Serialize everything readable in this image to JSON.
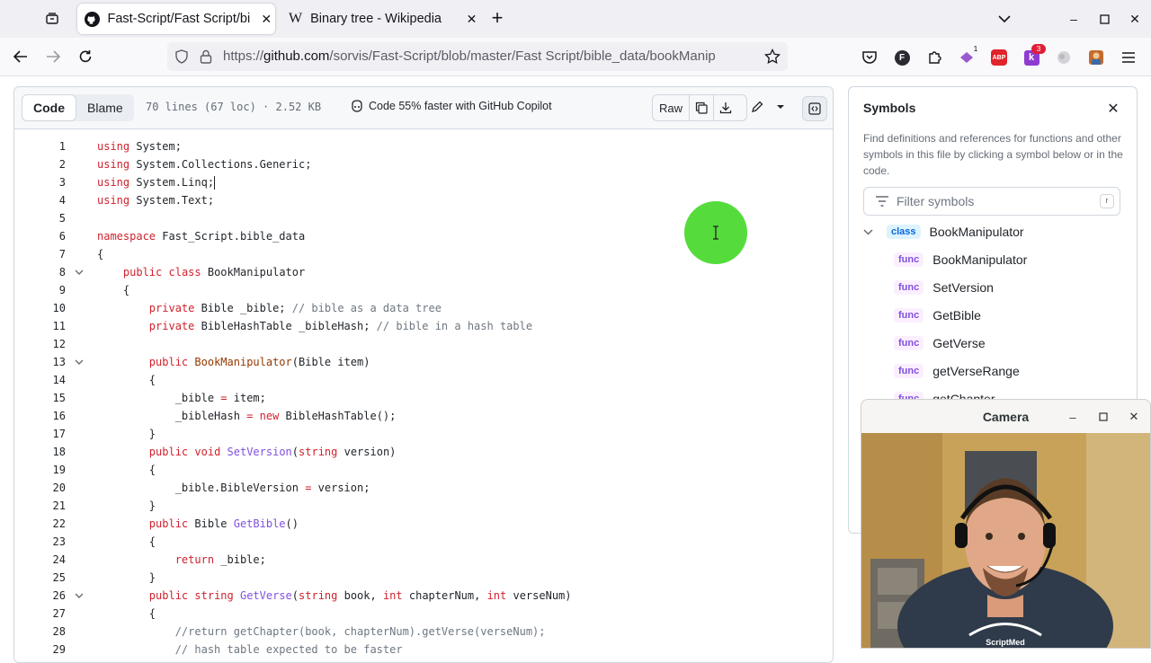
{
  "browser": {
    "tabs": [
      {
        "title": "Fast-Script/Fast Script/bi",
        "active": true
      },
      {
        "title": "Binary tree - Wikipedia",
        "active": false
      }
    ],
    "url_prefix": "https://",
    "url_host": "github.com",
    "url_path": "/sorvis/Fast-Script/blob/master/Fast Script/bible_data/bookManip",
    "ext_badges": {
      "notifications": "1",
      "k_extension": "3"
    },
    "profile_letter": "F",
    "abp_label": "ABP",
    "k_label": "k"
  },
  "file": {
    "code_tab": "Code",
    "blame_tab": "Blame",
    "meta": "70 lines (67 loc) · 2.52 KB",
    "copilot": "Code 55% faster with GitHub Copilot",
    "raw": "Raw"
  },
  "code_lines": [
    {
      "n": "1",
      "text": "using System;"
    },
    {
      "n": "2",
      "text": "using System.Collections.Generic;"
    },
    {
      "n": "3",
      "text": "using System.Linq;"
    },
    {
      "n": "4",
      "text": "using System.Text;"
    },
    {
      "n": "5",
      "text": ""
    },
    {
      "n": "6",
      "text": "namespace Fast_Script.bible_data"
    },
    {
      "n": "7",
      "text": "{"
    },
    {
      "n": "8",
      "text": "    public class BookManipulator"
    },
    {
      "n": "9",
      "text": "    {"
    },
    {
      "n": "10",
      "text": "        private Bible _bible; // bible as a data tree"
    },
    {
      "n": "11",
      "text": "        private BibleHashTable _bibleHash; // bible in a hash table"
    },
    {
      "n": "12",
      "text": ""
    },
    {
      "n": "13",
      "text": "        public BookManipulator(Bible item)"
    },
    {
      "n": "14",
      "text": "        {"
    },
    {
      "n": "15",
      "text": "            _bible = item;"
    },
    {
      "n": "16",
      "text": "            _bibleHash = new BibleHashTable();"
    },
    {
      "n": "17",
      "text": "        }"
    },
    {
      "n": "18",
      "text": "        public void SetVersion(string version)"
    },
    {
      "n": "19",
      "text": "        {"
    },
    {
      "n": "20",
      "text": "            _bible.BibleVersion = version;"
    },
    {
      "n": "21",
      "text": "        }"
    },
    {
      "n": "22",
      "text": "        public Bible GetBible()"
    },
    {
      "n": "23",
      "text": "        {"
    },
    {
      "n": "24",
      "text": "            return _bible;"
    },
    {
      "n": "25",
      "text": "        }"
    },
    {
      "n": "26",
      "text": "        public string GetVerse(string book, int chapterNum, int verseNum)"
    },
    {
      "n": "27",
      "text": "        {"
    },
    {
      "n": "28",
      "text": "            //return getChapter(book, chapterNum).getVerse(verseNum);"
    },
    {
      "n": "29",
      "text": "            // hash table expected to be faster"
    }
  ],
  "symbols": {
    "title": "Symbols",
    "description": "Find definitions and references for functions and other symbols in this file by clicking a symbol below or in the code.",
    "filter_placeholder": "Filter symbols",
    "filter_key": "r",
    "class_pill": "class",
    "func_pill": "func",
    "class_name": "BookManipulator",
    "funcs": [
      "BookManipulator",
      "SetVersion",
      "GetBible",
      "GetVerse",
      "getVerseRange",
      "getChapter"
    ]
  },
  "camera": {
    "title": "Camera",
    "shirt_text": "ScriptMed"
  },
  "colors": {
    "cursor_highlight": "#55dc3c",
    "keyword": "#cf222e",
    "function": "#8250df",
    "comment": "#6e7781"
  }
}
